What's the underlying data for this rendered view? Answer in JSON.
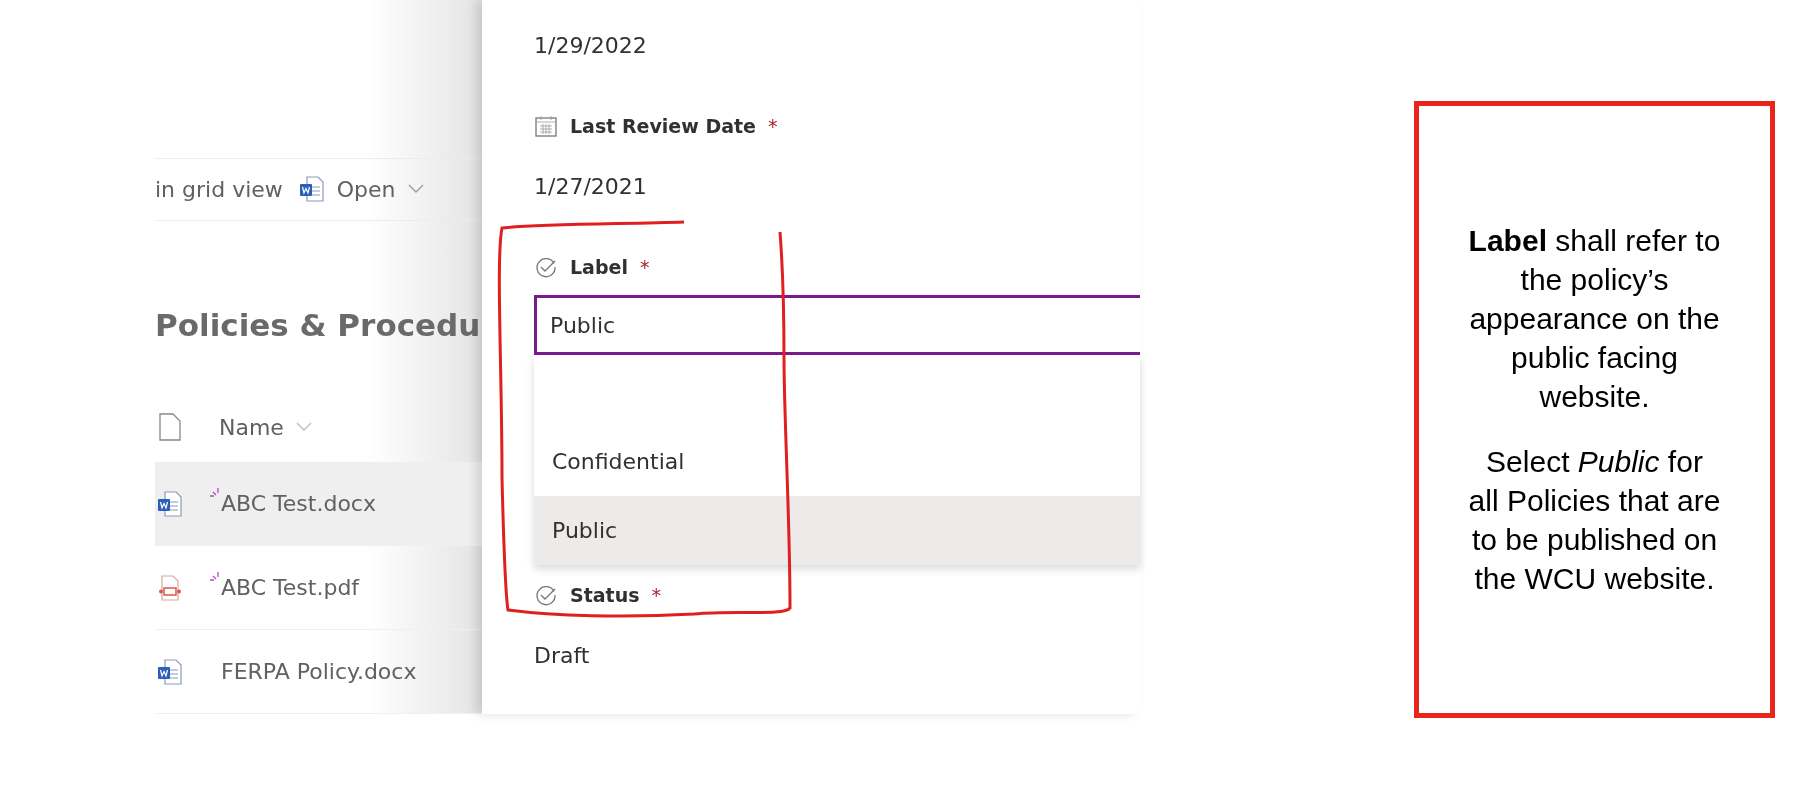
{
  "library": {
    "toolbar": {
      "view_text": "in grid view",
      "open_button": "Open"
    },
    "title": "Policies & Procedu",
    "column": "Name",
    "files": [
      {
        "name": "ABC Test.docx",
        "kind": "word",
        "selected": true,
        "new": true
      },
      {
        "name": "ABC Test.pdf",
        "kind": "pdf",
        "selected": false,
        "new": true
      },
      {
        "name": "FERPA Policy.docx",
        "kind": "word",
        "selected": false,
        "new": false
      }
    ]
  },
  "form": {
    "cut_value": "1/29/2022",
    "fields": [
      {
        "kind": "date",
        "label": "Last Review Date",
        "required_mark": "*",
        "value": "1/27/2021"
      },
      {
        "kind": "choice",
        "label": "Label",
        "required_mark": "*",
        "value": "Public",
        "focused": true,
        "options": [
          {
            "label": "Confidential",
            "selected": false
          },
          {
            "label": "Public",
            "selected": true
          }
        ]
      },
      {
        "kind": "choice",
        "label": "Status",
        "required_mark": "*",
        "value": "Draft",
        "focused": false
      }
    ]
  },
  "callout": {
    "paragraphs": [
      "**Label** shall refer to the policy’s appearance on the public facing website.",
      "Select *Public* for all Policies that are to be published on the WCU website."
    ]
  }
}
